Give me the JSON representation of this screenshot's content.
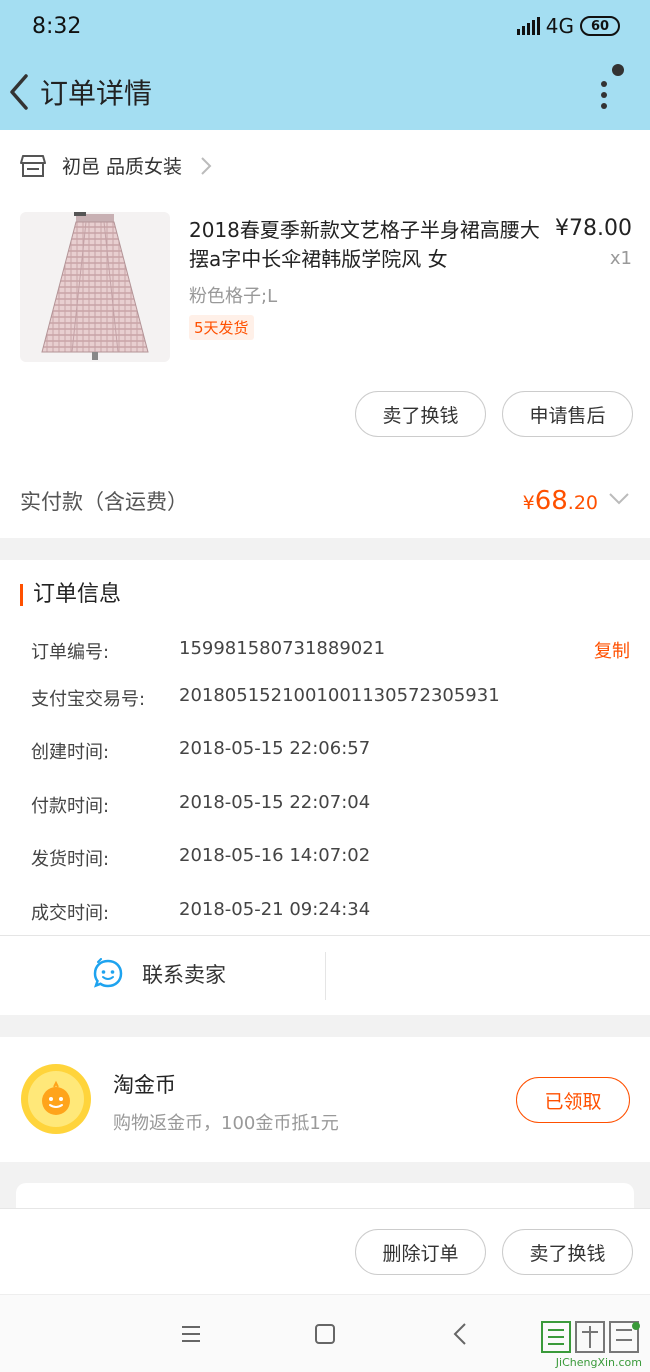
{
  "status_bar": {
    "time": "8:32",
    "network": "4G",
    "battery": "60"
  },
  "header": {
    "title": "订单详情"
  },
  "shop": {
    "name": "初邑 品质女装"
  },
  "product": {
    "title": "2018春夏季新款文艺格子半身裙高腰大摆a字中长伞裙韩版学院风 女",
    "price": "¥78.00",
    "quantity": "x1",
    "sku": "粉色格子;L",
    "shipping_badge": "5天发货"
  },
  "product_actions": {
    "resell": "卖了换钱",
    "after_sale": "申请售后"
  },
  "payment": {
    "label": "实付款（含运费）",
    "currency": "¥",
    "amount_int": "68",
    "amount_dec": ".20"
  },
  "order_info": {
    "header": "订单信息",
    "copy_label": "复制",
    "rows": [
      {
        "label": "订单编号:",
        "value": "159981580731889021"
      },
      {
        "label": "支付宝交易号:",
        "value": "2018051521001001130572305931"
      },
      {
        "label": "创建时间:",
        "value": "2018-05-15 22:06:57"
      },
      {
        "label": "付款时间:",
        "value": "2018-05-15 22:07:04"
      },
      {
        "label": "发货时间:",
        "value": "2018-05-16 14:07:02"
      },
      {
        "label": "成交时间:",
        "value": "2018-05-21 09:24:34"
      }
    ],
    "contact_seller": "联系卖家"
  },
  "coins": {
    "title": "淘金币",
    "desc": "购物返金币，100金币抵1元",
    "button": "已领取"
  },
  "bottom_actions": {
    "delete": "删除订单",
    "resell": "卖了换钱"
  },
  "watermark": {
    "text": "JiChengXin.com"
  },
  "colors": {
    "accent": "#ff5000",
    "header_bg": "#a4def2"
  }
}
